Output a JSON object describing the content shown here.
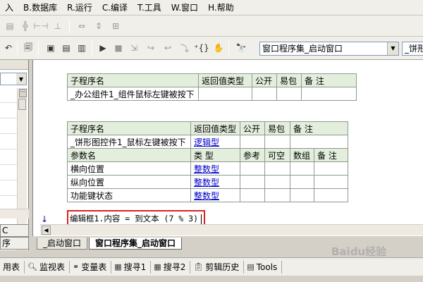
{
  "menu": [
    {
      "label": "插入",
      "shown": "入"
    },
    {
      "label": "B.数据库",
      "shown": "B.数据库"
    },
    {
      "label": "R.运行",
      "shown": "R.运行"
    },
    {
      "label": "C.编译",
      "shown": "C.编译"
    },
    {
      "label": "T.工具",
      "shown": "T.工具"
    },
    {
      "label": "W.窗口",
      "shown": "W.窗口"
    },
    {
      "label": "H.帮助",
      "shown": "H.帮助"
    }
  ],
  "toolbar": {
    "object_combo_value": "窗口程序集_启动窗口",
    "event_combo_value": "_饼形"
  },
  "editor": {
    "table1": {
      "headers": [
        "子程序名",
        "返回值类型",
        "公开",
        "易包",
        "备 注"
      ],
      "row": [
        "_办公组件1_组件鼠标左键被按下",
        "",
        "",
        "",
        ""
      ]
    },
    "table2": {
      "headers": [
        "子程序名",
        "返回值类型",
        "公开",
        "易包",
        "备 注"
      ],
      "row": [
        "_饼形图控件1_鼠标左键被按下",
        "逻辑型",
        "",
        "",
        ""
      ],
      "param_headers": [
        "参数名",
        "类 型",
        "参考",
        "可空",
        "数组",
        "备 注"
      ],
      "params": [
        {
          "name": "横向位置",
          "type": "整数型"
        },
        {
          "name": "纵向位置",
          "type": "整数型"
        },
        {
          "name": "功能键状态",
          "type": "整数型"
        }
      ]
    },
    "code_line": "编辑框1.内容 = 到文本 (7 % 3)",
    "arrow": "↓"
  },
  "left_panel": {
    "tab1": "C",
    "tab2": "序"
  },
  "doc_tabs": [
    {
      "label": "_启动窗口",
      "active": false
    },
    {
      "label": "窗口程序集_启动窗口",
      "active": true
    }
  ],
  "statusbar": [
    {
      "label": "用表",
      "icon": "table-icon"
    },
    {
      "label": "监视表",
      "icon": "magnifier-icon"
    },
    {
      "label": "变量表",
      "icon": "variables-icon"
    },
    {
      "label": "搜寻1",
      "icon": "search-window-icon"
    },
    {
      "label": "搜寻2",
      "icon": "search-window-icon"
    },
    {
      "label": "剪辑历史",
      "icon": "clipboard-icon"
    },
    {
      "label": "Tools",
      "icon": "tools-icon"
    }
  ],
  "watermark": "Baidu经验"
}
